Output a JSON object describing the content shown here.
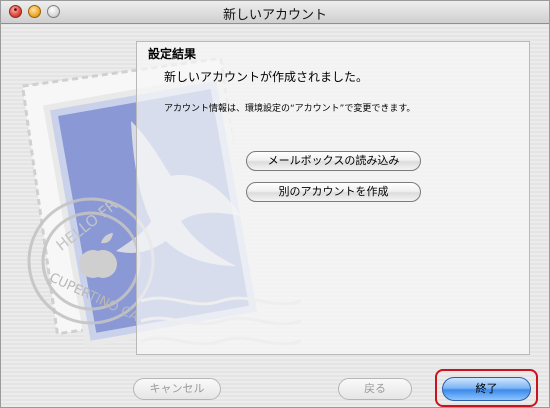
{
  "window": {
    "title": "新しいアカウント"
  },
  "titlebar_icons": {
    "close": "close-icon",
    "minimize": "minimize-icon",
    "zoom": "zoom-icon"
  },
  "artwork": {
    "stamp_text_top": "HELLO FR",
    "stamp_text_bottom": "CUPERTINO CA"
  },
  "panel": {
    "heading": "設定結果",
    "success_message": "新しいアカウントが作成されました。",
    "info_message": "アカウント情報は、環境設定の“アカウント”で変更できます。",
    "import_mailboxes_label": "メールボックスの読み込み",
    "create_another_label": "別のアカウントを作成"
  },
  "footer": {
    "cancel_label": "キャンセル",
    "back_label": "戻る",
    "finish_label": "終了"
  },
  "colors": {
    "default_button": "#3d8bea",
    "focus_ring": "#c8141d"
  }
}
